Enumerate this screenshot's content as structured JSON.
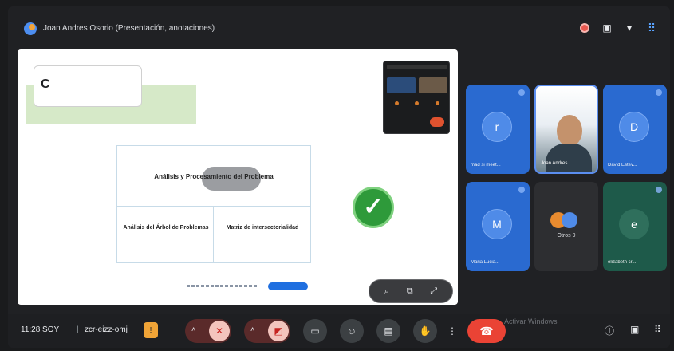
{
  "header": {
    "presenter_label": "Joan Andres Osorio (Presentación, anotaciones)",
    "icons": [
      "record-icon",
      "camera-icon",
      "chevron-down-icon",
      "participants-icon"
    ]
  },
  "slide": {
    "title_letter": "C",
    "diagram_main": "Análisis y Procesamiento del Problema",
    "diagram_left": "Análisis del Árbol de Problemas",
    "diagram_right": "Matriz de intersectorialidad",
    "controls": [
      "zoom-icon",
      "open-icon",
      "fullscreen-icon"
    ]
  },
  "participants": [
    {
      "label": "mad si meet...",
      "initial": "r",
      "style": "blue"
    },
    {
      "label": "Joan Andres...",
      "initial": "",
      "style": "face"
    },
    {
      "label": "David Estev...",
      "initial": "D",
      "style": "blue"
    },
    {
      "label": "Maria Lucia...",
      "initial": "M",
      "style": "blue"
    },
    {
      "label": "Otros 9",
      "initial": "",
      "style": "group"
    },
    {
      "label": "elizabeth cr...",
      "initial": "e",
      "style": "green"
    }
  ],
  "bottombar": {
    "time": "11:28 SOY",
    "separator": "|",
    "meeting_code": "zcr-eizz-omj",
    "hand_glyph": "!",
    "mic_glyph": "✕",
    "cam_glyph": "◩",
    "end_glyph": "☎",
    "watermark": "Activar Windows"
  },
  "colors": {
    "accent_blue": "#2a6ad0",
    "end_call": "#ea4335",
    "check_green": "#2e9a3a",
    "hand_badge": "#f0a437"
  }
}
